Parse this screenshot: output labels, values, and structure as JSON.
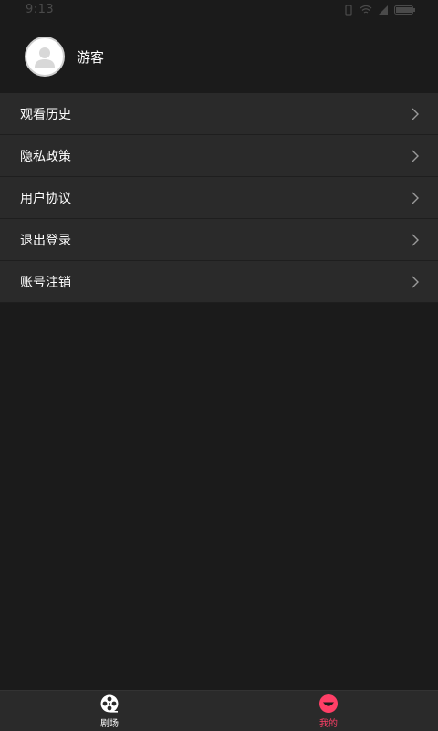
{
  "status_bar": {
    "time": "9:13",
    "icons": [
      "photo-icon",
      "vibrate-icon",
      "wifi-icon",
      "signal-icon",
      "battery-icon"
    ]
  },
  "profile": {
    "name": "游客",
    "avatar_icon": "person-icon"
  },
  "menu": {
    "items": [
      {
        "label": "观看历史",
        "icon": "chevron-right-icon"
      },
      {
        "label": "隐私政策",
        "icon": "chevron-right-icon"
      },
      {
        "label": "用户协议",
        "icon": "chevron-right-icon"
      },
      {
        "label": "退出登录",
        "icon": "chevron-right-icon"
      },
      {
        "label": "账号注销",
        "icon": "chevron-right-icon"
      }
    ]
  },
  "tab_bar": {
    "tabs": [
      {
        "label": "剧场",
        "icon": "film-reel-icon",
        "active": false
      },
      {
        "label": "我的",
        "icon": "smile-face-icon",
        "active": true
      }
    ]
  },
  "colors": {
    "background": "#1b1b1b",
    "menu_item": "#2a2a2a",
    "accent": "#ff3f67",
    "text": "#ffffff"
  }
}
